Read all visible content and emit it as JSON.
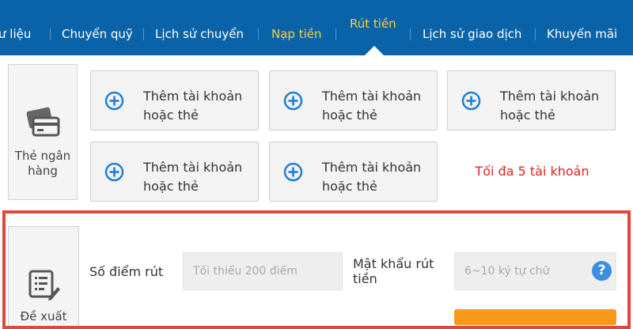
{
  "nav": {
    "items": [
      {
        "label": "ư liệu"
      },
      {
        "label": "Chuyển quỹ"
      },
      {
        "label": "Lịch sử chuyển"
      },
      {
        "label": "Nạp tiền"
      },
      {
        "label": "Rút tiền"
      },
      {
        "label": "Lịch sử giao dịch"
      },
      {
        "label": "Khuyến mãi"
      }
    ],
    "active_label": "Rút tiền",
    "highlight_color": "#f7d23a",
    "background_color": "#0a63a8"
  },
  "bank_section": {
    "label_line1": "Thẻ ngân",
    "label_line2": "hàng",
    "icon": "credit-cards-icon",
    "add_cards": [
      {
        "line1": "Thêm tài khoản",
        "line2": "hoặc thẻ"
      },
      {
        "line1": "Thêm tài khoản",
        "line2": "hoặc thẻ"
      },
      {
        "line1": "Thêm tài khoản",
        "line2": "hoặc thẻ"
      },
      {
        "line1": "Thêm tài khoản",
        "line2": "hoặc thẻ"
      },
      {
        "line1": "Thêm tài khoản",
        "line2": "hoặc thẻ"
      }
    ],
    "add_icon": "plus-circle-icon",
    "limit_note": "Tối đa 5 tài khoản",
    "limit_color": "#e2231a"
  },
  "withdraw_section": {
    "label": "Đề xuất",
    "icon": "document-edit-icon",
    "points_label": "Số điểm rút",
    "points_placeholder": "Tối thiểu 200 điểm",
    "password_label_line1": "Mật khẩu rút",
    "password_label_line2": "tiền",
    "password_placeholder": "6~10 ký tự chữ",
    "help_icon": "question-circle-icon",
    "help_text": "?",
    "border_color": "#e2453c",
    "submit_color": "#f79a1b"
  }
}
